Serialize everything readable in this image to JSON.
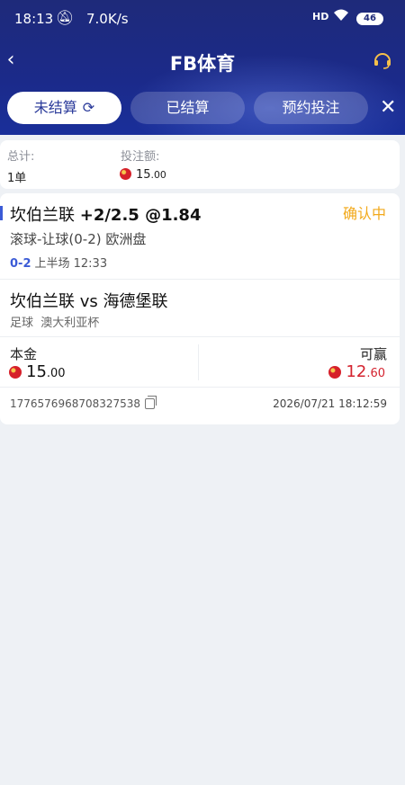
{
  "status_bar": {
    "time": "18:13",
    "speed": "7.0K/s",
    "network": "HD",
    "battery": "46",
    "icons": [
      "bell-off-icon",
      "signal-icon",
      "wifi-icon",
      "battery-icon"
    ]
  },
  "header": {
    "title": "FB体育",
    "back_icon": "back-arrow-icon",
    "support_icon": "headset-icon"
  },
  "tabs": [
    {
      "label": "未结算",
      "active": true
    },
    {
      "label": "已结算",
      "active": false
    },
    {
      "label": "预约投注",
      "active": false
    }
  ],
  "summary": {
    "total_label": "总计:",
    "total_value": "1单",
    "stake_label": "投注额:",
    "stake_value": "15",
    "stake_decimals": ".00"
  },
  "bet": {
    "team": "坎伯兰联",
    "pick": "+2/2.5 @1.84",
    "status": "确认中",
    "market": "滚球-让球(0-2) 欧洲盘",
    "score": "0-2",
    "period": "上半场 12:33",
    "match": "坎伯兰联 vs 海德堡联",
    "sport": "足球",
    "league": "澳大利亚杯",
    "principal_label": "本金",
    "principal_value": "15",
    "principal_decimals": ".00",
    "win_label": "可赢",
    "win_value": "12",
    "win_decimals": ".60",
    "order_no": "1776576968708327538",
    "order_time": "2026/07/21 18:12:59"
  },
  "colors": {
    "header_bg": "#1e2a7a",
    "accent": "#3b5bd6",
    "pending": "#f2a91b",
    "win": "#d4232f"
  }
}
